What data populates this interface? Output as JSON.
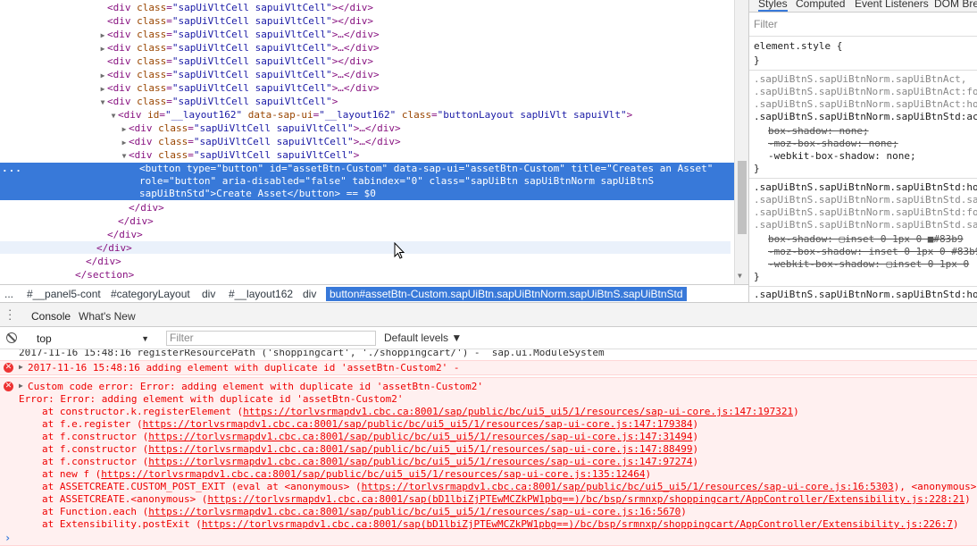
{
  "elements": {
    "lines": [
      {
        "indent": 120,
        "twisty": "",
        "parts": [
          [
            "tag",
            "<div "
          ],
          [
            "attr-name",
            "class"
          ],
          [
            "tag",
            "="
          ],
          [
            "attr-val",
            "\"sapUiVltCell sapuiVltCell\""
          ],
          [
            "tag",
            "></div>"
          ]
        ]
      },
      {
        "indent": 120,
        "twisty": "",
        "parts": [
          [
            "tag",
            "<div "
          ],
          [
            "attr-name",
            "class"
          ],
          [
            "tag",
            "="
          ],
          [
            "attr-val",
            "\"sapUiVltCell sapuiVltCell\""
          ],
          [
            "tag",
            "></div>"
          ]
        ]
      },
      {
        "indent": 120,
        "twisty": "▶",
        "parts": [
          [
            "tag",
            "<div "
          ],
          [
            "attr-name",
            "class"
          ],
          [
            "tag",
            "="
          ],
          [
            "attr-val",
            "\"sapUiVltCell sapuiVltCell\""
          ],
          [
            "tag",
            ">…</div>"
          ]
        ]
      },
      {
        "indent": 120,
        "twisty": "▶",
        "parts": [
          [
            "tag",
            "<div "
          ],
          [
            "attr-name",
            "class"
          ],
          [
            "tag",
            "="
          ],
          [
            "attr-val",
            "\"sapUiVltCell sapuiVltCell\""
          ],
          [
            "tag",
            ">…</div>"
          ]
        ]
      },
      {
        "indent": 120,
        "twisty": "",
        "parts": [
          [
            "tag",
            "<div "
          ],
          [
            "attr-name",
            "class"
          ],
          [
            "tag",
            "="
          ],
          [
            "attr-val",
            "\"sapUiVltCell sapuiVltCell\""
          ],
          [
            "tag",
            "></div>"
          ]
        ]
      },
      {
        "indent": 120,
        "twisty": "▶",
        "parts": [
          [
            "tag",
            "<div "
          ],
          [
            "attr-name",
            "class"
          ],
          [
            "tag",
            "="
          ],
          [
            "attr-val",
            "\"sapUiVltCell sapuiVltCell\""
          ],
          [
            "tag",
            ">…</div>"
          ]
        ]
      },
      {
        "indent": 120,
        "twisty": "▶",
        "parts": [
          [
            "tag",
            "<div "
          ],
          [
            "attr-name",
            "class"
          ],
          [
            "tag",
            "="
          ],
          [
            "attr-val",
            "\"sapUiVltCell sapuiVltCell\""
          ],
          [
            "tag",
            ">…</div>"
          ]
        ]
      },
      {
        "indent": 120,
        "twisty": "▼",
        "parts": [
          [
            "tag",
            "<div "
          ],
          [
            "attr-name",
            "class"
          ],
          [
            "tag",
            "="
          ],
          [
            "attr-val",
            "\"sapUiVltCell sapuiVltCell\""
          ],
          [
            "tag",
            ">"
          ]
        ]
      },
      {
        "indent": 132,
        "twisty": "▼",
        "parts": [
          [
            "tag",
            "<div "
          ],
          [
            "attr-name",
            "id"
          ],
          [
            "tag",
            "="
          ],
          [
            "attr-val",
            "\"__layout162\""
          ],
          [
            "tag",
            " "
          ],
          [
            "attr-name",
            "data-sap-ui"
          ],
          [
            "tag",
            "="
          ],
          [
            "attr-val",
            "\"__layout162\""
          ],
          [
            "tag",
            " "
          ],
          [
            "attr-name",
            "class"
          ],
          [
            "tag",
            "="
          ],
          [
            "attr-val",
            "\"buttonLayout sapUiVlt sapuiVlt\""
          ],
          [
            "tag",
            ">"
          ]
        ]
      },
      {
        "indent": 144,
        "twisty": "▶",
        "parts": [
          [
            "tag",
            "<div "
          ],
          [
            "attr-name",
            "class"
          ],
          [
            "tag",
            "="
          ],
          [
            "attr-val",
            "\"sapUiVltCell sapuiVltCell\""
          ],
          [
            "tag",
            ">…</div>"
          ]
        ]
      },
      {
        "indent": 144,
        "twisty": "▶",
        "parts": [
          [
            "tag",
            "<div "
          ],
          [
            "attr-name",
            "class"
          ],
          [
            "tag",
            "="
          ],
          [
            "attr-val",
            "\"sapUiVltCell sapuiVltCell\""
          ],
          [
            "tag",
            ">…</div>"
          ]
        ]
      },
      {
        "indent": 144,
        "twisty": "▼",
        "parts": [
          [
            "tag",
            "<div "
          ],
          [
            "attr-name",
            "class"
          ],
          [
            "tag",
            "="
          ],
          [
            "attr-val",
            "\"sapUiVltCell sapuiVltCell\""
          ],
          [
            "tag",
            ">"
          ]
        ]
      }
    ],
    "selected": [
      "<button type=\"button\" id=\"assetBtn-Custom\" data-sap-ui=\"assetBtn-Custom\" title=\"Creates an Asset\"",
      "role=\"button\" aria-disabled=\"false\" tabindex=\"0\" class=\"sapUiBtn sapUiBtnNorm sapUiBtnS",
      "sapUiBtnStd\">Create Asset</button> == $0"
    ],
    "dots": "...",
    "closing": [
      {
        "indent": 144,
        "text": "</div>"
      },
      {
        "indent": 132,
        "text": "</div>"
      },
      {
        "indent": 120,
        "text": "</div>"
      },
      {
        "indent": 108,
        "text": "</div>"
      },
      {
        "indent": 96,
        "text": "</div>"
      },
      {
        "indent": 84,
        "text": "</section>"
      }
    ]
  },
  "styles": {
    "tabs": [
      "Styles",
      "Computed",
      "Event Listeners",
      "DOM Bre"
    ],
    "filter_placeholder": "Filter",
    "element_style": "element.style {",
    "close_brace": "}",
    "rule1_selectors": [
      ".sapUiBtnS.sapUiBtnNorm.sapUiBtnAct,",
      ".sapUiBtnS.sapUiBtnNorm.sapUiBtnAct:fo",
      ".sapUiBtnS.sapUiBtnNorm.sapUiBtnAct:ho",
      ".sapUiBtnS.sapUiBtnNorm.sapUiBtnStd:ac"
    ],
    "rule1_props": [
      "box-shadow: none;",
      "-moz-box-shadow: none;",
      "-webkit-box-shadow: none;"
    ],
    "rule2_selectors": [
      ".sapUiBtnS.sapUiBtnNorm.sapUiBtnStd:ho",
      ".sapUiBtnS.sapUiBtnNorm.sapUiBtnStd.sa",
      ".sapUiBtnS.sapUiBtnNorm.sapUiBtnStd:fo",
      ".sapUiBtnS.sapUiBtnNorm.sapUiBtnStd.sa"
    ],
    "rule2_props": [
      "box-shadow: ▢inset 0 1px 0 ■#83b9",
      "-moz-box-shadow: inset 0 1px 0 #83b9",
      "-webkit-box-shadow: ▢inset 0 1px 0"
    ],
    "rule3_selector": ".sapUiBtnS.sapUiBtnNorm.sapUiBtnStd:ho"
  },
  "breadcrumbs": [
    "...",
    "#__panel5-cont",
    "#categoryLayout",
    "div",
    "#__layout162",
    "div",
    "button#assetBtn-Custom.sapUiBtn.sapUiBtnNorm.sapUiBtnS.sapUiBtnStd"
  ],
  "drawer": {
    "tabs": [
      "Console",
      "What's New"
    ]
  },
  "console_toolbar": {
    "context": "top",
    "filter_placeholder": "Filter",
    "levels": "Default levels ▼"
  },
  "console": {
    "line0": "2017-11-16 15:48:16 registerResourcePath ('shoppingcart', './shoppingcart/') -  sap.ui.ModuleSystem",
    "err1": "2017-11-16 15:48:16 adding element with duplicate id 'assetBtn-Custom2' -",
    "err2_title": "Custom code error: Error: adding element with duplicate id 'assetBtn-Custom2'",
    "err2_msg": "Error: Error: adding element with duplicate id 'assetBtn-Custom2'",
    "frames": [
      {
        "pre": "at constructor.k.registerElement (",
        "url": "https://torlvsrmapdv1.cbc.ca:8001/sap/public/bc/ui5_ui5/1/resources/sap-ui-core.js:147:197321",
        "post": ")"
      },
      {
        "pre": "at f.e.register (",
        "url": "https://torlvsrmapdv1.cbc.ca:8001/sap/public/bc/ui5_ui5/1/resources/sap-ui-core.js:147:179384",
        "post": ")"
      },
      {
        "pre": "at f.constructor (",
        "url": "https://torlvsrmapdv1.cbc.ca:8001/sap/public/bc/ui5_ui5/1/resources/sap-ui-core.js:147:31494",
        "post": ")"
      },
      {
        "pre": "at f.constructor (",
        "url": "https://torlvsrmapdv1.cbc.ca:8001/sap/public/bc/ui5_ui5/1/resources/sap-ui-core.js:147:88499",
        "post": ")"
      },
      {
        "pre": "at f.constructor (",
        "url": "https://torlvsrmapdv1.cbc.ca:8001/sap/public/bc/ui5_ui5/1/resources/sap-ui-core.js:147:97274",
        "post": ")"
      },
      {
        "pre": "at new f (",
        "url": "https://torlvsrmapdv1.cbc.ca:8001/sap/public/bc/ui5_ui5/1/resources/sap-ui-core.js:135:12464",
        "post": ")"
      },
      {
        "pre": "at ASSETCREATE.CUSTOM_POST_EXIT (eval at <anonymous> (",
        "url": "https://torlvsrmapdv1.cbc.ca:8001/sap/public/bc/ui5_ui5/1/resources/sap-ui-core.js:16:5303",
        "post": "), <anonymous>:"
      },
      {
        "pre": "at ASSETCREATE.<anonymous> (",
        "url": "https://torlvsrmapdv1.cbc.ca:8001/sap(bD1lbiZjPTEwMCZkPW1pbg==)/bc/bsp/srmnxp/shoppingcart/AppController/Extensibility.js:228:21",
        "post": ")"
      },
      {
        "pre": "at Function.each (",
        "url": "https://torlvsrmapdv1.cbc.ca:8001/sap/public/bc/ui5_ui5/1/resources/sap-ui-core.js:16:5670",
        "post": ")"
      },
      {
        "pre": "at Extensibility.postExit (",
        "url": "https://torlvsrmapdv1.cbc.ca:8001/sap(bD1lbiZjPTEwMCZkPW1pbg==)/bc/bsp/srmnxp/shoppingcart/AppController/Extensibility.js:226:7",
        "post": ")"
      }
    ],
    "prompt": "›"
  }
}
